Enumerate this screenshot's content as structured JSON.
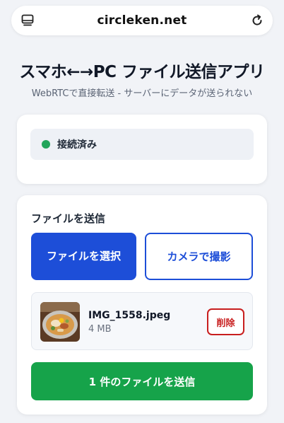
{
  "browser": {
    "url": "circleken.net",
    "tabs_icon": "tabs-icon",
    "reload_icon": "reload-icon"
  },
  "header": {
    "title": "スマホ←→PC ファイル送信アプリ",
    "subtitle": "WebRTCで直接転送 - サーバーにデータが送られない"
  },
  "status": {
    "text": "接続済み",
    "color": "#22a55b"
  },
  "send": {
    "section_title": "ファイルを送信",
    "choose_label": "ファイルを選択",
    "camera_label": "カメラで撮影",
    "files": [
      {
        "name": "IMG_1558.jpeg",
        "size": "4 MB",
        "delete_label": "削除"
      }
    ],
    "send_label": "1 件のファイルを送信"
  },
  "colors": {
    "primary": "#1d4ed8",
    "success": "#16a34a",
    "danger": "#c81e1e"
  }
}
